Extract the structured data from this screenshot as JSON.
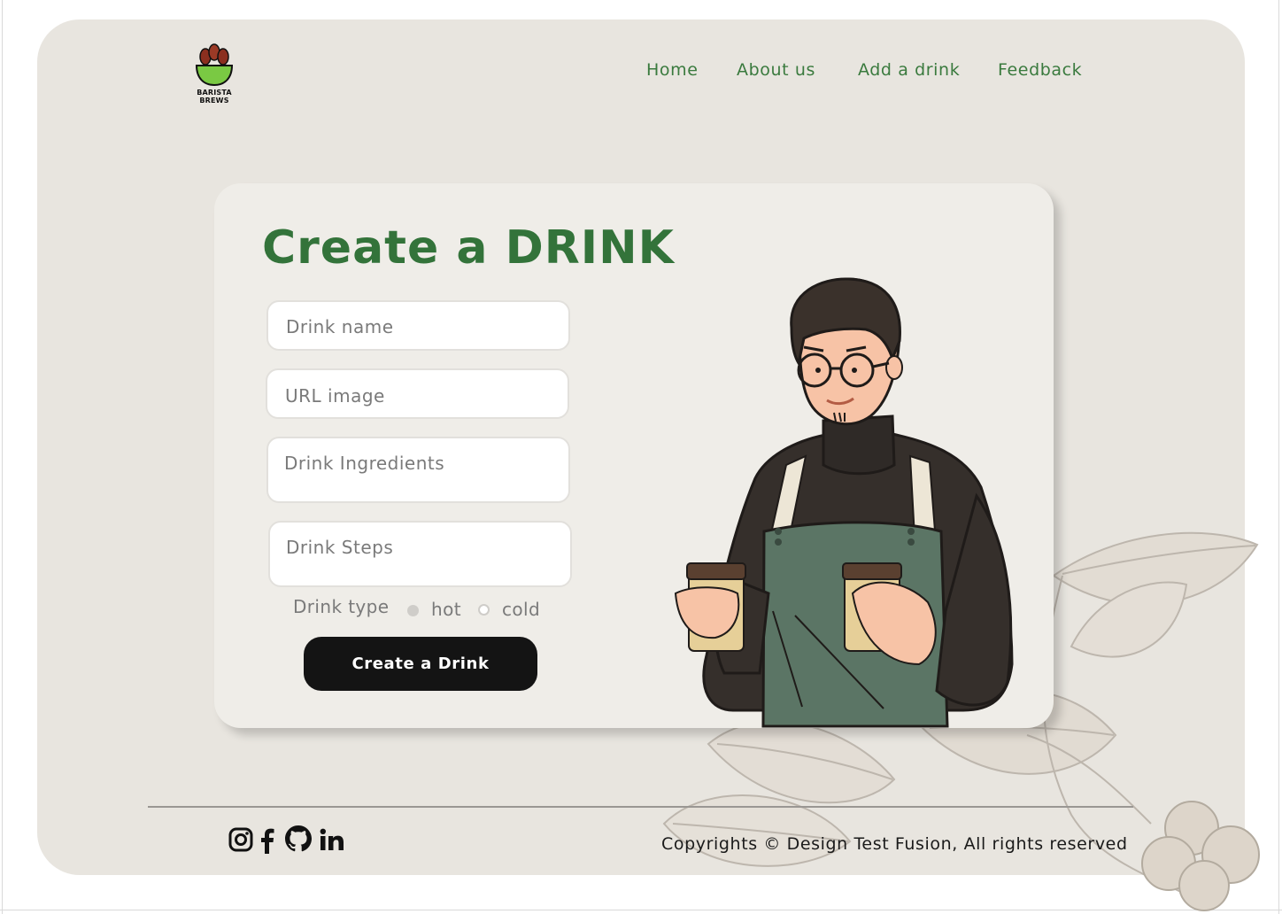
{
  "brand": {
    "logo_text_line1": "BARISTA",
    "logo_text_line2": "BREWS"
  },
  "nav": {
    "items": [
      {
        "label": "Home"
      },
      {
        "label": "About us"
      },
      {
        "label": "Add a drink"
      },
      {
        "label": "Feedback"
      }
    ]
  },
  "form": {
    "title": "Create a DRINK",
    "drink_name_placeholder": "Drink name",
    "url_image_placeholder": "URL image",
    "ingredients_placeholder": "Drink Ingredients",
    "steps_placeholder": "Drink Steps",
    "drink_type_label": "Drink type",
    "option_hot": "hot",
    "option_cold": "cold",
    "submit_label": "Create a Drink"
  },
  "footer": {
    "copyright": "Copyrights © Design Test Fusion, All rights reserved",
    "social": [
      "instagram-icon",
      "facebook-icon",
      "github-icon",
      "linkedin-icon"
    ]
  },
  "colors": {
    "accent_green": "#33733a",
    "nav_green": "#3a7a3e",
    "page_bg": "#e8e5df",
    "card_bg": "#efede8",
    "button_bg": "#141414"
  }
}
